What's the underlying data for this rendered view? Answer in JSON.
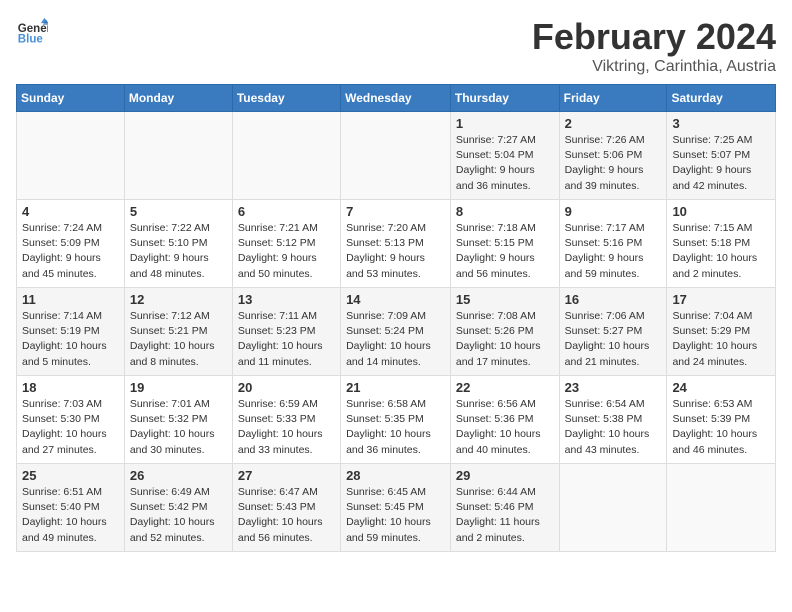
{
  "logo": {
    "line1": "General",
    "line2": "Blue"
  },
  "title": "February 2024",
  "subtitle": "Viktring, Carinthia, Austria",
  "weekdays": [
    "Sunday",
    "Monday",
    "Tuesday",
    "Wednesday",
    "Thursday",
    "Friday",
    "Saturday"
  ],
  "weeks": [
    [
      {
        "day": "",
        "info": ""
      },
      {
        "day": "",
        "info": ""
      },
      {
        "day": "",
        "info": ""
      },
      {
        "day": "",
        "info": ""
      },
      {
        "day": "1",
        "info": "Sunrise: 7:27 AM\nSunset: 5:04 PM\nDaylight: 9 hours\nand 36 minutes."
      },
      {
        "day": "2",
        "info": "Sunrise: 7:26 AM\nSunset: 5:06 PM\nDaylight: 9 hours\nand 39 minutes."
      },
      {
        "day": "3",
        "info": "Sunrise: 7:25 AM\nSunset: 5:07 PM\nDaylight: 9 hours\nand 42 minutes."
      }
    ],
    [
      {
        "day": "4",
        "info": "Sunrise: 7:24 AM\nSunset: 5:09 PM\nDaylight: 9 hours\nand 45 minutes."
      },
      {
        "day": "5",
        "info": "Sunrise: 7:22 AM\nSunset: 5:10 PM\nDaylight: 9 hours\nand 48 minutes."
      },
      {
        "day": "6",
        "info": "Sunrise: 7:21 AM\nSunset: 5:12 PM\nDaylight: 9 hours\nand 50 minutes."
      },
      {
        "day": "7",
        "info": "Sunrise: 7:20 AM\nSunset: 5:13 PM\nDaylight: 9 hours\nand 53 minutes."
      },
      {
        "day": "8",
        "info": "Sunrise: 7:18 AM\nSunset: 5:15 PM\nDaylight: 9 hours\nand 56 minutes."
      },
      {
        "day": "9",
        "info": "Sunrise: 7:17 AM\nSunset: 5:16 PM\nDaylight: 9 hours\nand 59 minutes."
      },
      {
        "day": "10",
        "info": "Sunrise: 7:15 AM\nSunset: 5:18 PM\nDaylight: 10 hours\nand 2 minutes."
      }
    ],
    [
      {
        "day": "11",
        "info": "Sunrise: 7:14 AM\nSunset: 5:19 PM\nDaylight: 10 hours\nand 5 minutes."
      },
      {
        "day": "12",
        "info": "Sunrise: 7:12 AM\nSunset: 5:21 PM\nDaylight: 10 hours\nand 8 minutes."
      },
      {
        "day": "13",
        "info": "Sunrise: 7:11 AM\nSunset: 5:23 PM\nDaylight: 10 hours\nand 11 minutes."
      },
      {
        "day": "14",
        "info": "Sunrise: 7:09 AM\nSunset: 5:24 PM\nDaylight: 10 hours\nand 14 minutes."
      },
      {
        "day": "15",
        "info": "Sunrise: 7:08 AM\nSunset: 5:26 PM\nDaylight: 10 hours\nand 17 minutes."
      },
      {
        "day": "16",
        "info": "Sunrise: 7:06 AM\nSunset: 5:27 PM\nDaylight: 10 hours\nand 21 minutes."
      },
      {
        "day": "17",
        "info": "Sunrise: 7:04 AM\nSunset: 5:29 PM\nDaylight: 10 hours\nand 24 minutes."
      }
    ],
    [
      {
        "day": "18",
        "info": "Sunrise: 7:03 AM\nSunset: 5:30 PM\nDaylight: 10 hours\nand 27 minutes."
      },
      {
        "day": "19",
        "info": "Sunrise: 7:01 AM\nSunset: 5:32 PM\nDaylight: 10 hours\nand 30 minutes."
      },
      {
        "day": "20",
        "info": "Sunrise: 6:59 AM\nSunset: 5:33 PM\nDaylight: 10 hours\nand 33 minutes."
      },
      {
        "day": "21",
        "info": "Sunrise: 6:58 AM\nSunset: 5:35 PM\nDaylight: 10 hours\nand 36 minutes."
      },
      {
        "day": "22",
        "info": "Sunrise: 6:56 AM\nSunset: 5:36 PM\nDaylight: 10 hours\nand 40 minutes."
      },
      {
        "day": "23",
        "info": "Sunrise: 6:54 AM\nSunset: 5:38 PM\nDaylight: 10 hours\nand 43 minutes."
      },
      {
        "day": "24",
        "info": "Sunrise: 6:53 AM\nSunset: 5:39 PM\nDaylight: 10 hours\nand 46 minutes."
      }
    ],
    [
      {
        "day": "25",
        "info": "Sunrise: 6:51 AM\nSunset: 5:40 PM\nDaylight: 10 hours\nand 49 minutes."
      },
      {
        "day": "26",
        "info": "Sunrise: 6:49 AM\nSunset: 5:42 PM\nDaylight: 10 hours\nand 52 minutes."
      },
      {
        "day": "27",
        "info": "Sunrise: 6:47 AM\nSunset: 5:43 PM\nDaylight: 10 hours\nand 56 minutes."
      },
      {
        "day": "28",
        "info": "Sunrise: 6:45 AM\nSunset: 5:45 PM\nDaylight: 10 hours\nand 59 minutes."
      },
      {
        "day": "29",
        "info": "Sunrise: 6:44 AM\nSunset: 5:46 PM\nDaylight: 11 hours\nand 2 minutes."
      },
      {
        "day": "",
        "info": ""
      },
      {
        "day": "",
        "info": ""
      }
    ]
  ]
}
